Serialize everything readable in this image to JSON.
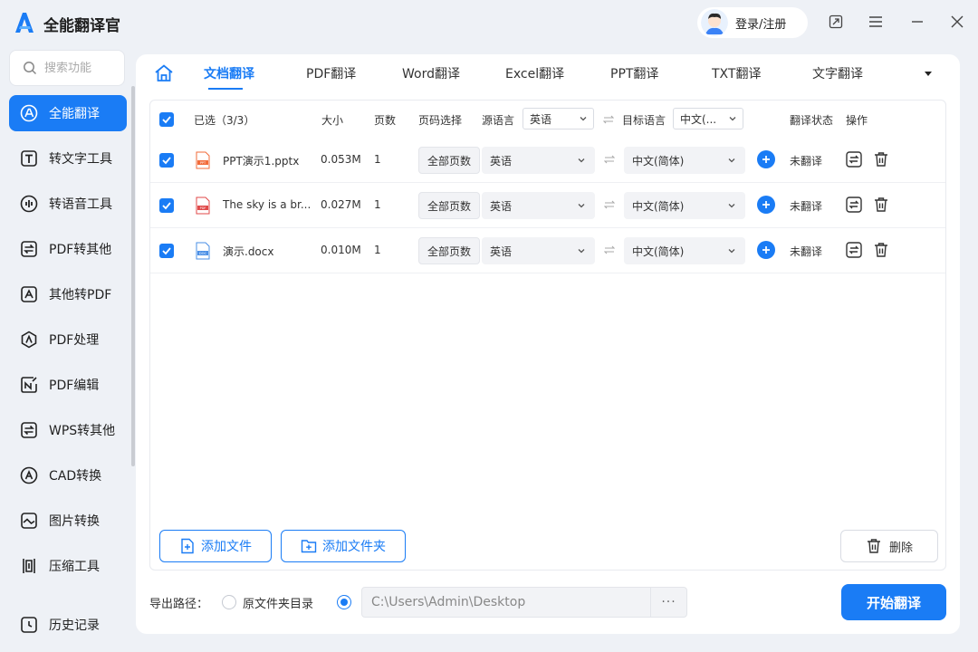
{
  "app": {
    "title": "全能翻译官",
    "login_label": "登录/注册"
  },
  "sidebar": {
    "search_placeholder": "搜索功能",
    "items": [
      {
        "label": "全能翻译",
        "icon": "translate-icon",
        "active": true
      },
      {
        "label": "转文字工具",
        "icon": "text-t-icon"
      },
      {
        "label": "转语音工具",
        "icon": "audio-icon"
      },
      {
        "label": "PDF转其他",
        "icon": "pdf-convert-icon"
      },
      {
        "label": "其他转PDF",
        "icon": "to-pdf-icon"
      },
      {
        "label": "PDF处理",
        "icon": "pdf-process-icon"
      },
      {
        "label": "PDF编辑",
        "icon": "pdf-edit-icon"
      },
      {
        "label": "WPS转其他",
        "icon": "wps-icon"
      },
      {
        "label": "CAD转换",
        "icon": "cad-icon"
      },
      {
        "label": "图片转换",
        "icon": "image-icon"
      },
      {
        "label": "压缩工具",
        "icon": "compress-icon"
      }
    ],
    "history_label": "历史记录"
  },
  "tabs": {
    "items": [
      "文档翻译",
      "PDF翻译",
      "Word翻译",
      "Excel翻译",
      "PPT翻译",
      "TXT翻译",
      "文字翻译"
    ],
    "active": 0
  },
  "table": {
    "headers": {
      "selected": "已选（3/3）",
      "size": "大小",
      "pages": "页数",
      "page_select": "页码选择",
      "source_lang": "源语言",
      "source_lang_value": "英语",
      "target_lang": "目标语言",
      "target_lang_value": "中文(...",
      "status": "翻译状态",
      "actions": "操作"
    },
    "rows": [
      {
        "name": "PPT演示1.pptx",
        "type": "ppt",
        "size": "0.053M",
        "pages": "1",
        "page_select": "全部页数",
        "source": "英语",
        "target": "中文(简体)",
        "status": "未翻译"
      },
      {
        "name": "The sky is a br...",
        "type": "pdf",
        "size": "0.027M",
        "pages": "1",
        "page_select": "全部页数",
        "source": "英语",
        "target": "中文(简体)",
        "status": "未翻译"
      },
      {
        "name": "演示.docx",
        "type": "doc",
        "size": "0.010M",
        "pages": "1",
        "page_select": "全部页数",
        "source": "英语",
        "target": "中文(简体)",
        "status": "未翻译"
      }
    ]
  },
  "buttons": {
    "add_file": "添加文件",
    "add_folder": "添加文件夹",
    "delete": "删除",
    "start": "开始翻译"
  },
  "export": {
    "label": "导出路径：",
    "option_original": "原文件夹目录",
    "path": "C:\\Users\\Admin\\Desktop",
    "more": "···",
    "selected": "custom"
  },
  "colors": {
    "accent": "#1a7cf5",
    "background": "#eef1f6",
    "ppt": "#f26b3a",
    "pdf": "#e04a4a",
    "doc": "#4a8fe6"
  }
}
